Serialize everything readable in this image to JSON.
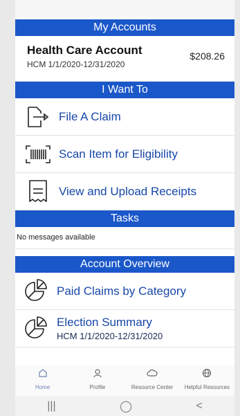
{
  "my_accounts": {
    "header": "My Accounts",
    "account": {
      "name": "Health Care Account",
      "period": "HCM 1/1/2020-12/31/2020",
      "balance": "$208.26"
    }
  },
  "i_want_to": {
    "header": "I Want To",
    "items": [
      {
        "label": "File A Claim",
        "icon": "file-claim-icon"
      },
      {
        "label": "Scan Item for Eligibility",
        "icon": "barcode-scan-icon"
      },
      {
        "label": "View and Upload Receipts",
        "icon": "receipt-icon"
      }
    ]
  },
  "tasks": {
    "header": "Tasks",
    "message": "No messages available"
  },
  "overview": {
    "header": "Account Overview",
    "items": [
      {
        "label": "Paid Claims by Category",
        "icon": "pie-chart-icon"
      },
      {
        "label": "Election Summary",
        "sub": "HCM 1/1/2020-12/31/2020",
        "icon": "pie-chart-icon"
      }
    ]
  },
  "tabbar": {
    "items": [
      {
        "label": "Home",
        "icon": "home-icon",
        "active": true
      },
      {
        "label": "Profile",
        "icon": "profile-icon"
      },
      {
        "label": "Resource Center",
        "icon": "cloud-icon"
      },
      {
        "label": "Helpful Resources",
        "icon": "globe-icon"
      }
    ]
  },
  "system_nav": {
    "recent": "|||",
    "home": "◯",
    "back": "<"
  },
  "colors": {
    "header_bg": "#1a57c9",
    "link": "#1747a8"
  }
}
